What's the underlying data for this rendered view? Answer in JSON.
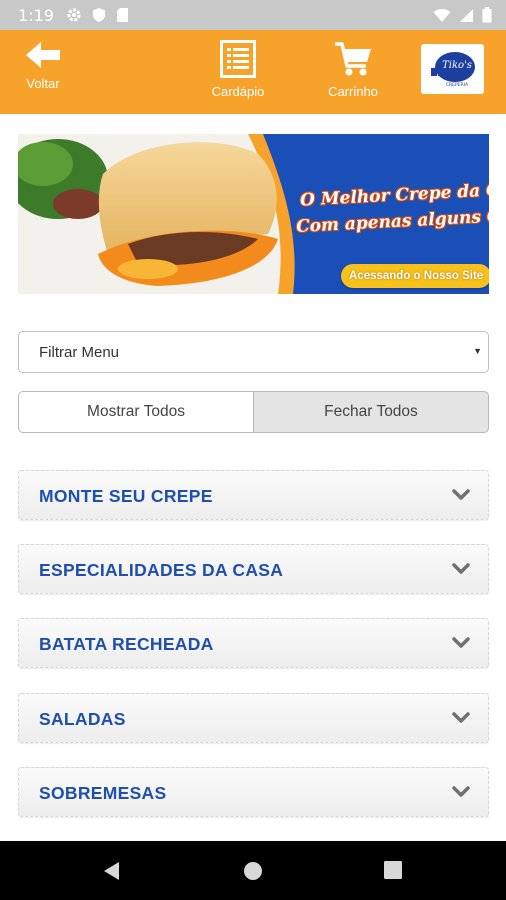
{
  "status_bar": {
    "time": "1:19",
    "left_icons": [
      "gear-icon",
      "shield-icon",
      "sd-card-icon"
    ],
    "right_icons": [
      "wifi-icon",
      "signal-icon",
      "battery-icon"
    ]
  },
  "app_bar": {
    "color": "#f7a22b",
    "back_label": "Voltar",
    "menu_label": "Cardápio",
    "cart_label": "Carrinho",
    "logo_text": "Tiko's",
    "logo_subtext": "CREPERIA"
  },
  "banner": {
    "line1": "O Melhor Crepe da Cidade",
    "line2": "Com apenas alguns Cliques!",
    "cta": "Acessando o Nosso Site"
  },
  "filter": {
    "selected": "Filtrar Menu"
  },
  "toggles": {
    "show_all": "Mostrar Todos",
    "close_all": "Fechar Todos"
  },
  "categories": [
    "MONTE SEU CREPE",
    "ESPECIALIDADES DA CASA",
    "BATATA RECHEADA",
    "SALADAS",
    "SOBREMESAS"
  ],
  "colors": {
    "accent": "#f7a22b",
    "category_text": "#1f4fad",
    "banner_blue": "#1a4fb8"
  }
}
